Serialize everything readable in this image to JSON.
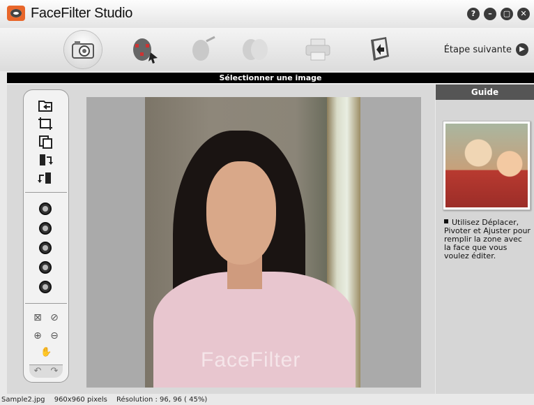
{
  "app": {
    "title": "FaceFilter Studio"
  },
  "window_controls": [
    {
      "name": "help-button",
      "glyph": "?"
    },
    {
      "name": "minimize-button",
      "glyph": "–"
    },
    {
      "name": "maximize-button",
      "glyph": "▢"
    },
    {
      "name": "close-button",
      "glyph": "✕"
    }
  ],
  "toolbar": {
    "steps": [
      {
        "name": "step-select-image",
        "icon": "camera-icon",
        "active": true
      },
      {
        "name": "step-detect-face",
        "icon": "face-detect-icon",
        "active": false
      },
      {
        "name": "step-edit-face",
        "icon": "face-edit-icon",
        "active": false
      },
      {
        "name": "step-compare",
        "icon": "face-compare-icon",
        "active": false
      },
      {
        "name": "step-print",
        "icon": "printer-icon",
        "active": false
      },
      {
        "name": "step-finish",
        "icon": "exit-icon",
        "active": false
      }
    ],
    "next_label": "Étape suivante"
  },
  "section_title": "Sélectionner une image",
  "guide": {
    "header": "Guide",
    "text": "Utilisez Déplacer, Pivoter et Ajuster pour remplir la zone avec la face que vous voulez éditer."
  },
  "photo": {
    "watermark": "FaceFilter"
  },
  "status": {
    "filename": "Sample2.jpg",
    "size": "960x960 pixels",
    "resolution": "Résolution : 96, 96 ( 45%)"
  }
}
